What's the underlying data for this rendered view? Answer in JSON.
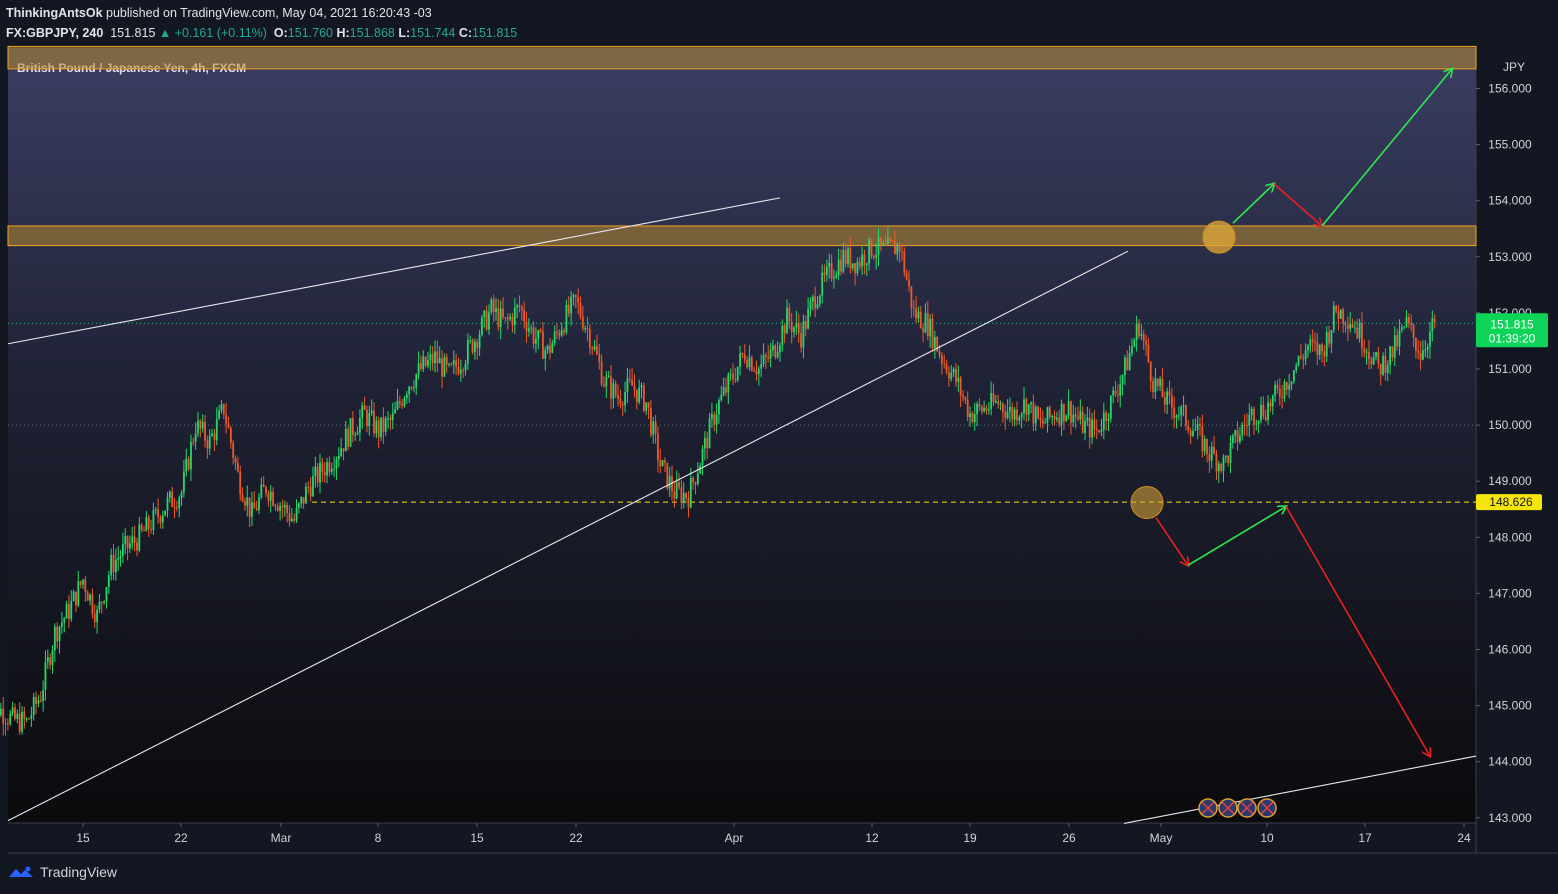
{
  "header": {
    "author": "ThinkingAntsOk",
    "published_text": "published on TradingView.com, May 04, 2021 16:20:43 -03"
  },
  "ohlc": {
    "symbol": "FX:GBPJPY, 240",
    "last": "151.815",
    "change": "+0.161 (+0.11%)",
    "o_label": "O:",
    "o": "151.760",
    "h_label": "H:",
    "h": "151.868",
    "l_label": "L:",
    "l": "151.744",
    "c_label": "C:",
    "c": "151.815"
  },
  "colors": {
    "background_top": "#3a3f63",
    "background_bottom": "#0b0b0d",
    "up": "#26d96a",
    "down": "#ef5a2a",
    "zone_fill": "#b8892f",
    "zone_border": "#f0a020",
    "level_line": "#f5e50c",
    "arrow_up": "#2ee84a",
    "arrow_down": "#e82020",
    "price_badge": "#0fd45a"
  },
  "chart_data": {
    "type": "candlestick",
    "title": "British Pound / Japanese Yen, 4h, FXCM",
    "currency_label": "JPY",
    "y_ticks": [
      "156.000",
      "155.000",
      "154.000",
      "153.000",
      "152.000",
      "151.000",
      "150.000",
      "149.000",
      "148.000",
      "147.000",
      "146.000",
      "145.000",
      "144.000",
      "143.000"
    ],
    "ylim": [
      142.9,
      156.75
    ],
    "x_ticks": [
      "15",
      "22",
      "Mar",
      "8",
      "15",
      "22",
      "Apr",
      "12",
      "19",
      "26",
      "May",
      "10",
      "17",
      "24"
    ],
    "current_price": "151.815",
    "countdown": "01:39:20",
    "key_level": "148.626",
    "resistance_zones": [
      {
        "from": 156.35,
        "to": 156.75
      },
      {
        "from": 153.2,
        "to": 153.55
      }
    ],
    "price_path": [
      {
        "date": "2021-02-08",
        "close": 144.2
      },
      {
        "date": "2021-02-09",
        "close": 144.95
      },
      {
        "date": "2021-02-10",
        "close": 144.75
      },
      {
        "date": "2021-02-11",
        "close": 144.7
      },
      {
        "date": "2021-02-12",
        "close": 145.2
      },
      {
        "date": "2021-02-13",
        "close": 146.3
      },
      {
        "date": "2021-02-14",
        "close": 146.7
      },
      {
        "date": "2021-02-15",
        "close": 147.25
      },
      {
        "date": "2021-02-16",
        "close": 146.6
      },
      {
        "date": "2021-02-17",
        "close": 147.5
      },
      {
        "date": "2021-02-18",
        "close": 147.8
      },
      {
        "date": "2021-02-19",
        "close": 148.0
      },
      {
        "date": "2021-02-20",
        "close": 148.3
      },
      {
        "date": "2021-02-21",
        "close": 148.6
      },
      {
        "date": "2021-02-22",
        "close": 148.8
      },
      {
        "date": "2021-02-23",
        "close": 150.0
      },
      {
        "date": "2021-02-24",
        "close": 149.7
      },
      {
        "date": "2021-02-25",
        "close": 150.3
      },
      {
        "date": "2021-02-26",
        "close": 149.1
      },
      {
        "date": "2021-02-27",
        "close": 148.4
      },
      {
        "date": "2021-02-28",
        "close": 148.9
      },
      {
        "date": "2021-03-01",
        "close": 148.6
      },
      {
        "date": "2021-03-02",
        "close": 148.3
      },
      {
        "date": "2021-03-03",
        "close": 148.9
      },
      {
        "date": "2021-03-04",
        "close": 149.2
      },
      {
        "date": "2021-03-05",
        "close": 149.5
      },
      {
        "date": "2021-03-06",
        "close": 149.9
      },
      {
        "date": "2021-03-07",
        "close": 150.2
      },
      {
        "date": "2021-03-08",
        "close": 149.9
      },
      {
        "date": "2021-03-09",
        "close": 150.1
      },
      {
        "date": "2021-03-10",
        "close": 150.7
      },
      {
        "date": "2021-03-11",
        "close": 151.0
      },
      {
        "date": "2021-03-12",
        "close": 151.2
      },
      {
        "date": "2021-03-13",
        "close": 150.9
      },
      {
        "date": "2021-03-14",
        "close": 151.2
      },
      {
        "date": "2021-03-15",
        "close": 151.6
      },
      {
        "date": "2021-03-16",
        "close": 152.05
      },
      {
        "date": "2021-03-17",
        "close": 151.8
      },
      {
        "date": "2021-03-18",
        "close": 152.1
      },
      {
        "date": "2021-03-19",
        "close": 151.6
      },
      {
        "date": "2021-03-20",
        "close": 151.3
      },
      {
        "date": "2021-03-21",
        "close": 151.8
      },
      {
        "date": "2021-03-22",
        "close": 152.2
      },
      {
        "date": "2021-03-23",
        "close": 151.6
      },
      {
        "date": "2021-03-24",
        "close": 150.8
      },
      {
        "date": "2021-03-25",
        "close": 150.5
      },
      {
        "date": "2021-03-26",
        "close": 150.7
      },
      {
        "date": "2021-03-27",
        "close": 150.4
      },
      {
        "date": "2021-03-28",
        "close": 149.3
      },
      {
        "date": "2021-03-29",
        "close": 148.8
      },
      {
        "date": "2021-03-30",
        "close": 148.75
      },
      {
        "date": "2021-03-31",
        "close": 149.5
      },
      {
        "date": "2021-04-01",
        "close": 150.3
      },
      {
        "date": "2021-04-02",
        "close": 150.8
      },
      {
        "date": "2021-04-03",
        "close": 151.3
      },
      {
        "date": "2021-04-04",
        "close": 151.0
      },
      {
        "date": "2021-04-05",
        "close": 151.3
      },
      {
        "date": "2021-04-06",
        "close": 151.9
      },
      {
        "date": "2021-04-07",
        "close": 151.6
      },
      {
        "date": "2021-04-08",
        "close": 152.3
      },
      {
        "date": "2021-04-09",
        "close": 152.7
      },
      {
        "date": "2021-04-10",
        "close": 153.0
      },
      {
        "date": "2021-04-11",
        "close": 152.9
      },
      {
        "date": "2021-04-12",
        "close": 153.15
      },
      {
        "date": "2021-04-13",
        "close": 153.1
      },
      {
        "date": "2021-04-14",
        "close": 153.2
      },
      {
        "date": "2021-04-15",
        "close": 152.0
      },
      {
        "date": "2021-04-16",
        "close": 151.8
      },
      {
        "date": "2021-04-17",
        "close": 151.2
      },
      {
        "date": "2021-04-18",
        "close": 150.8
      },
      {
        "date": "2021-04-19",
        "close": 150.2
      },
      {
        "date": "2021-04-20",
        "close": 150.3
      },
      {
        "date": "2021-04-21",
        "close": 150.4
      },
      {
        "date": "2021-04-22",
        "close": 150.2
      },
      {
        "date": "2021-04-23",
        "close": 150.4
      },
      {
        "date": "2021-04-24",
        "close": 150.0
      },
      {
        "date": "2021-04-25",
        "close": 150.2
      },
      {
        "date": "2021-04-26",
        "close": 150.3
      },
      {
        "date": "2021-04-27",
        "close": 150.0
      },
      {
        "date": "2021-04-28",
        "close": 149.9
      },
      {
        "date": "2021-04-29",
        "close": 150.4
      },
      {
        "date": "2021-04-30",
        "close": 151.0
      },
      {
        "date": "2021-05-01",
        "close": 151.8
      },
      {
        "date": "2021-05-02",
        "close": 150.8
      },
      {
        "date": "2021-05-03",
        "close": 150.4
      },
      {
        "date": "2021-05-04",
        "close": 150.2
      },
      {
        "date": "2021-05-05",
        "close": 149.9
      },
      {
        "date": "2021-05-06",
        "close": 149.5
      },
      {
        "date": "2021-05-07",
        "close": 149.3
      },
      {
        "date": "2021-05-08",
        "close": 149.8
      },
      {
        "date": "2021-05-09",
        "close": 150.2
      },
      {
        "date": "2021-05-10",
        "close": 150.3
      },
      {
        "date": "2021-05-11",
        "close": 150.6
      },
      {
        "date": "2021-05-12",
        "close": 151.0
      },
      {
        "date": "2021-05-13",
        "close": 151.4
      },
      {
        "date": "2021-05-14",
        "close": 151.3
      },
      {
        "date": "2021-05-15",
        "close": 152.05
      },
      {
        "date": "2021-05-16",
        "close": 151.9
      },
      {
        "date": "2021-05-17",
        "close": 151.5
      },
      {
        "date": "2021-05-18",
        "close": 151.0
      },
      {
        "date": "2021-05-19",
        "close": 151.3
      },
      {
        "date": "2021-05-20",
        "close": 151.8
      },
      {
        "date": "2021-05-21",
        "close": 151.3
      },
      {
        "date": "2021-05-22",
        "close": 151.815
      }
    ]
  }
}
